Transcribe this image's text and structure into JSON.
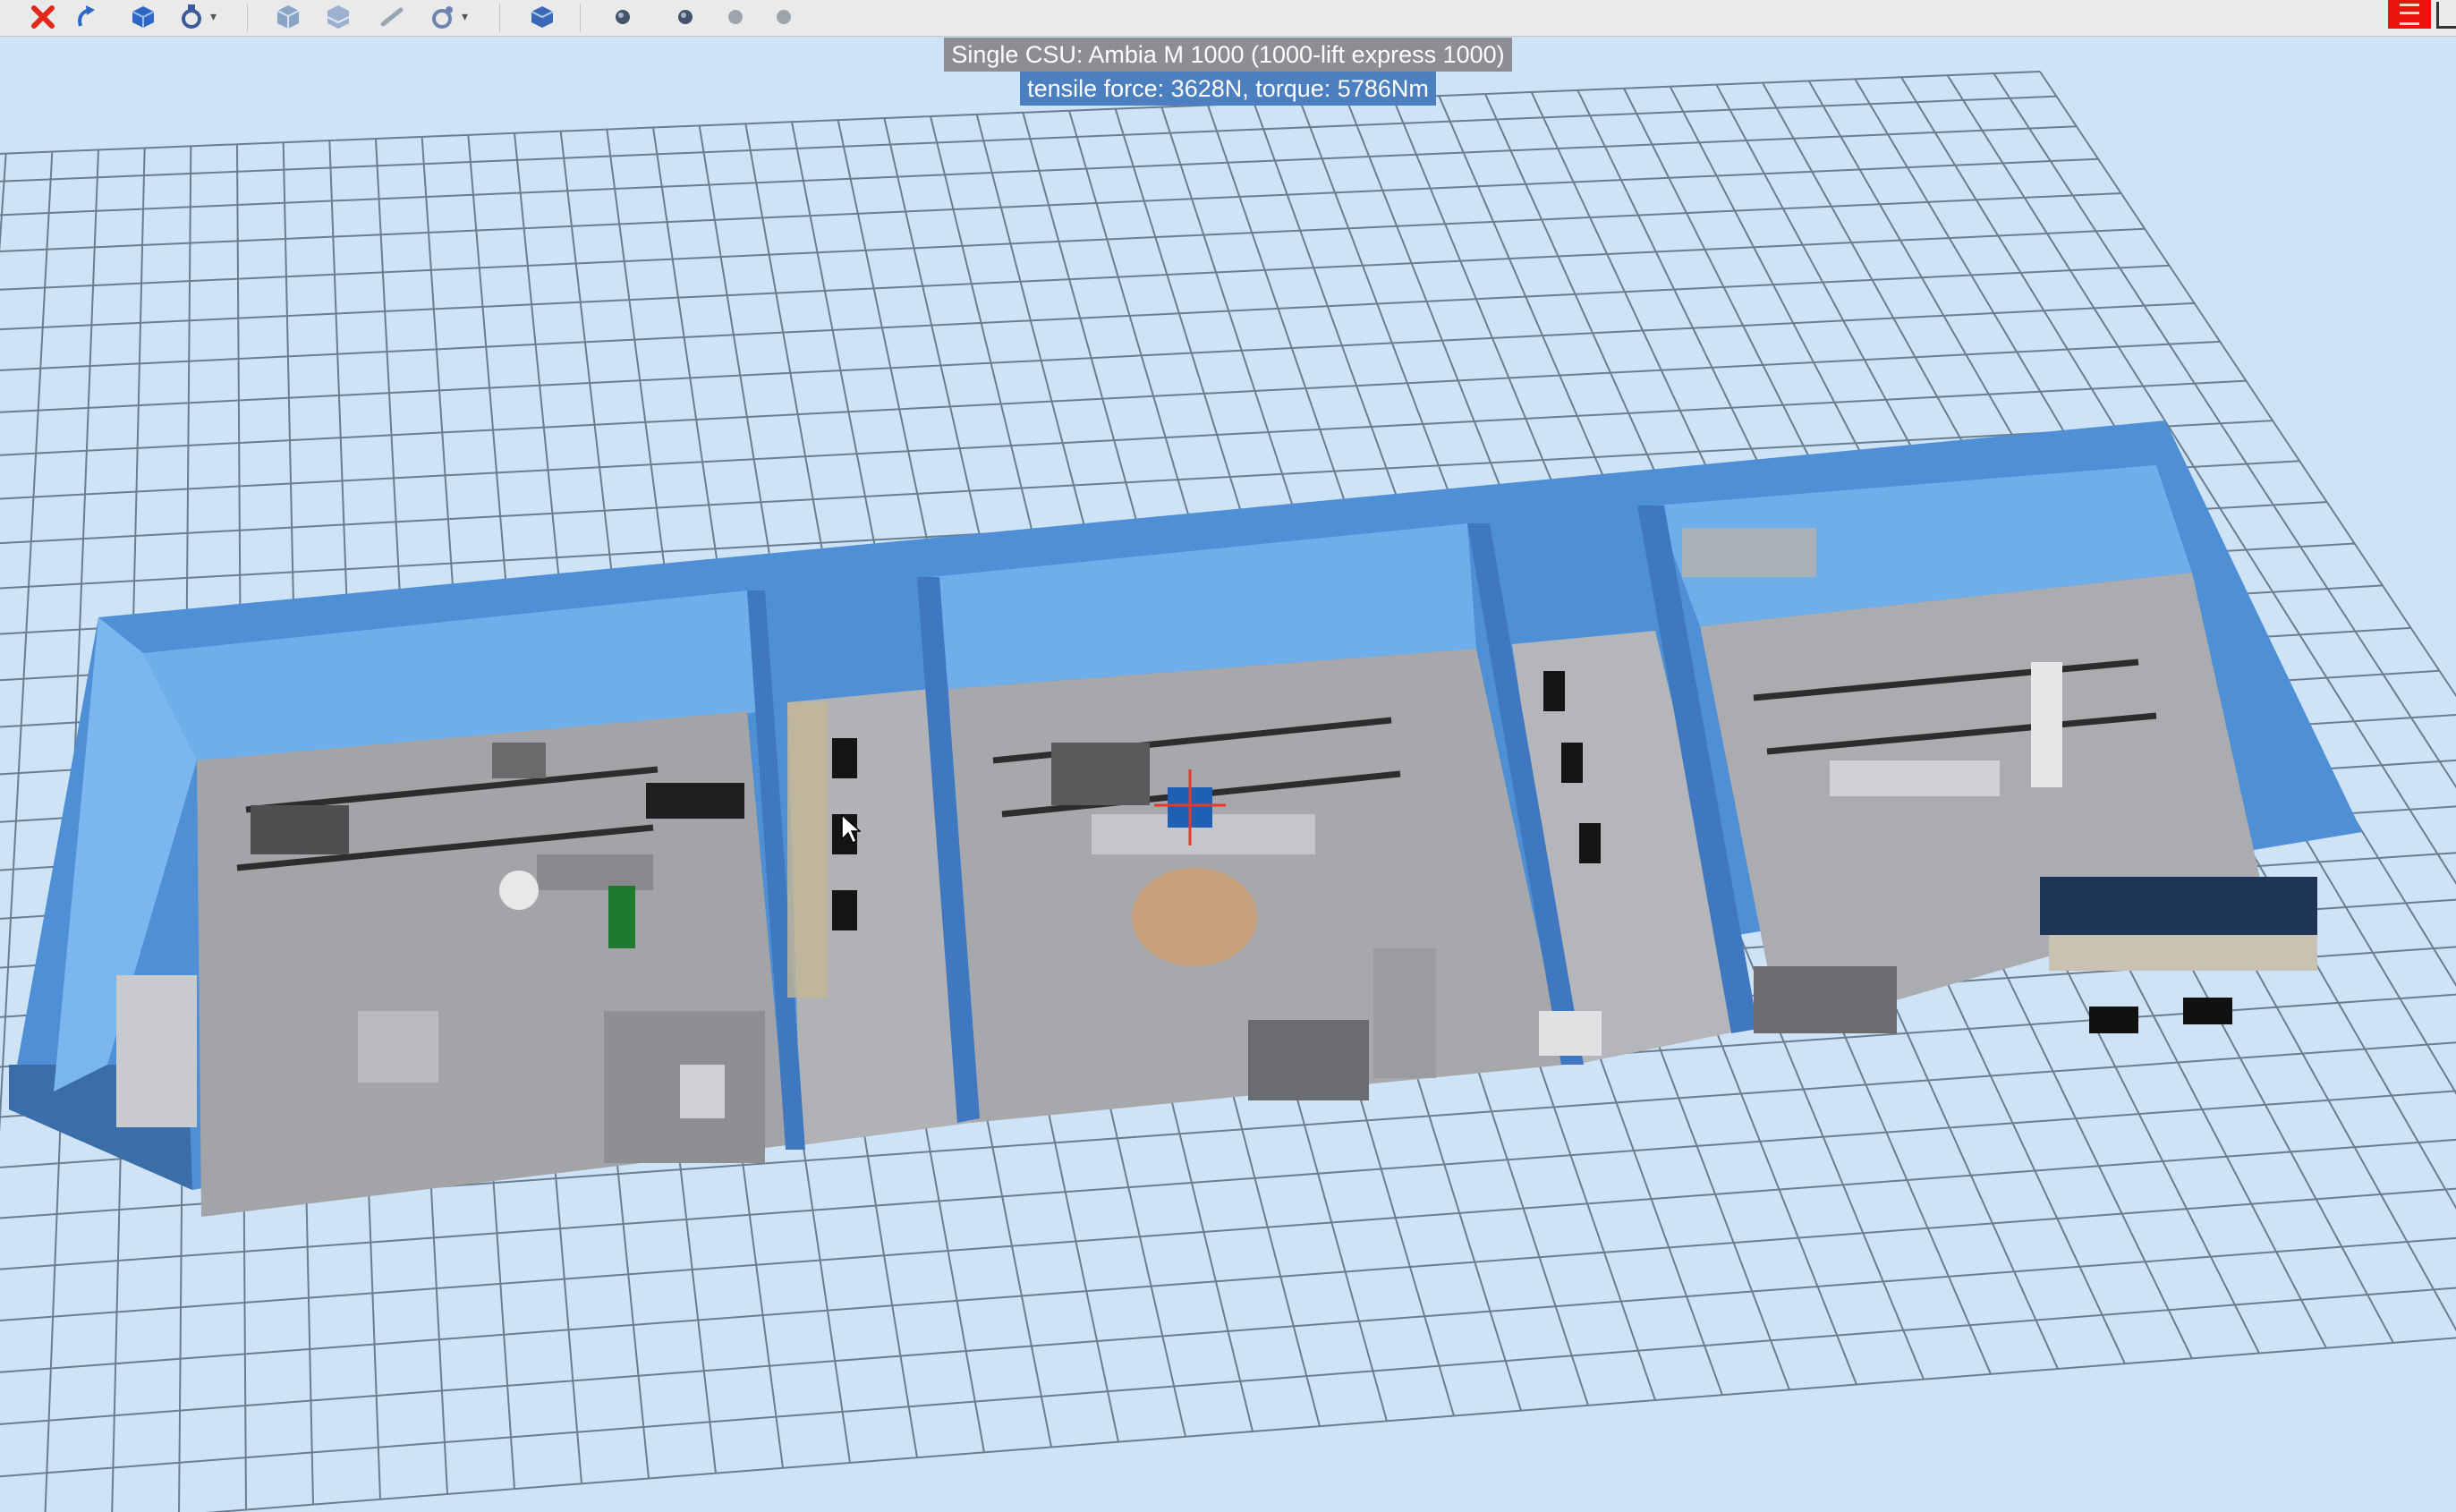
{
  "toolbar": {
    "items": [
      {
        "name": "delete-icon",
        "color": "#e02a1e"
      },
      {
        "name": "undo-icon",
        "color": "#2c67c8"
      },
      {
        "name": "cube-add-icon",
        "color": "#2c67c8"
      },
      {
        "name": "rotate-settings-icon",
        "color": "#3a5c9a"
      },
      {
        "name": "cube-group-icon",
        "color": "#8aa4c6"
      },
      {
        "name": "cube-stack-icon",
        "color": "#8aa4c6"
      },
      {
        "name": "link-icon",
        "color": "#9aa5b3"
      },
      {
        "name": "orbit-icon",
        "color": "#6b85b0"
      },
      {
        "name": "cube-view-icon",
        "color": "#3b69b8"
      },
      {
        "name": "camera-1-icon",
        "color": "#44546b"
      },
      {
        "name": "camera-2-icon",
        "color": "#44546b"
      },
      {
        "name": "camera-3-icon",
        "color": "#9ca4ae"
      },
      {
        "name": "camera-4-icon",
        "color": "#9ca4ae"
      }
    ],
    "right_button_icon": "menu-icon"
  },
  "viewport": {
    "info_title": "Single CSU: Ambia M 1000 (1000-lift express 1000)",
    "info_forces": "tensile force: 3628N, torque: 5786Nm"
  },
  "colors": {
    "background": "#cfe3f7",
    "grid_line": "#6b7d8e",
    "wall_blue": "#5c9fe0",
    "wall_top": "#3f6fa3",
    "floor": "#a2a4a7",
    "selection": "#1f5fb4",
    "info_title_bg": "#8d8d94",
    "info_forces_bg": "#4c7fc0"
  }
}
